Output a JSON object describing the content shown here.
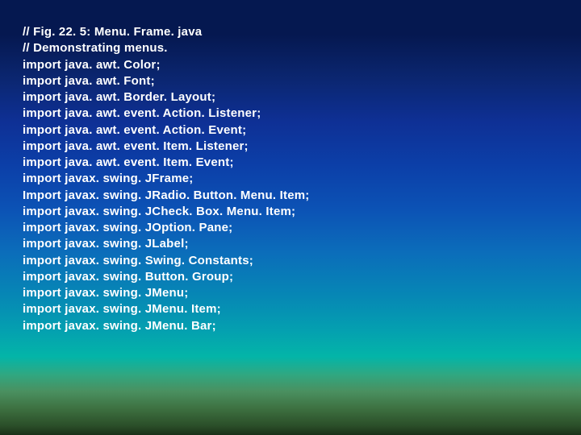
{
  "code": {
    "lines": [
      "// Fig. 22. 5: Menu. Frame. java",
      "// Demonstrating menus.",
      "import java. awt. Color;",
      "import java. awt. Font;",
      "import java. awt. Border. Layout;",
      "import java. awt. event. Action. Listener;",
      "import java. awt. event. Action. Event;",
      "import java. awt. event. Item. Listener;",
      "import java. awt. event. Item. Event;",
      "import javax. swing. JFrame;",
      "Import javax. swing. JRadio. Button. Menu. Item;",
      "import javax. swing. JCheck. Box. Menu. Item;",
      "import javax. swing. JOption. Pane;",
      "import javax. swing. JLabel;",
      "import javax. swing. Swing. Constants;",
      "import javax. swing. Button. Group;",
      "import javax. swing. JMenu;",
      "import javax. swing. JMenu. Item;",
      "import javax. swing. JMenu. Bar;"
    ]
  }
}
